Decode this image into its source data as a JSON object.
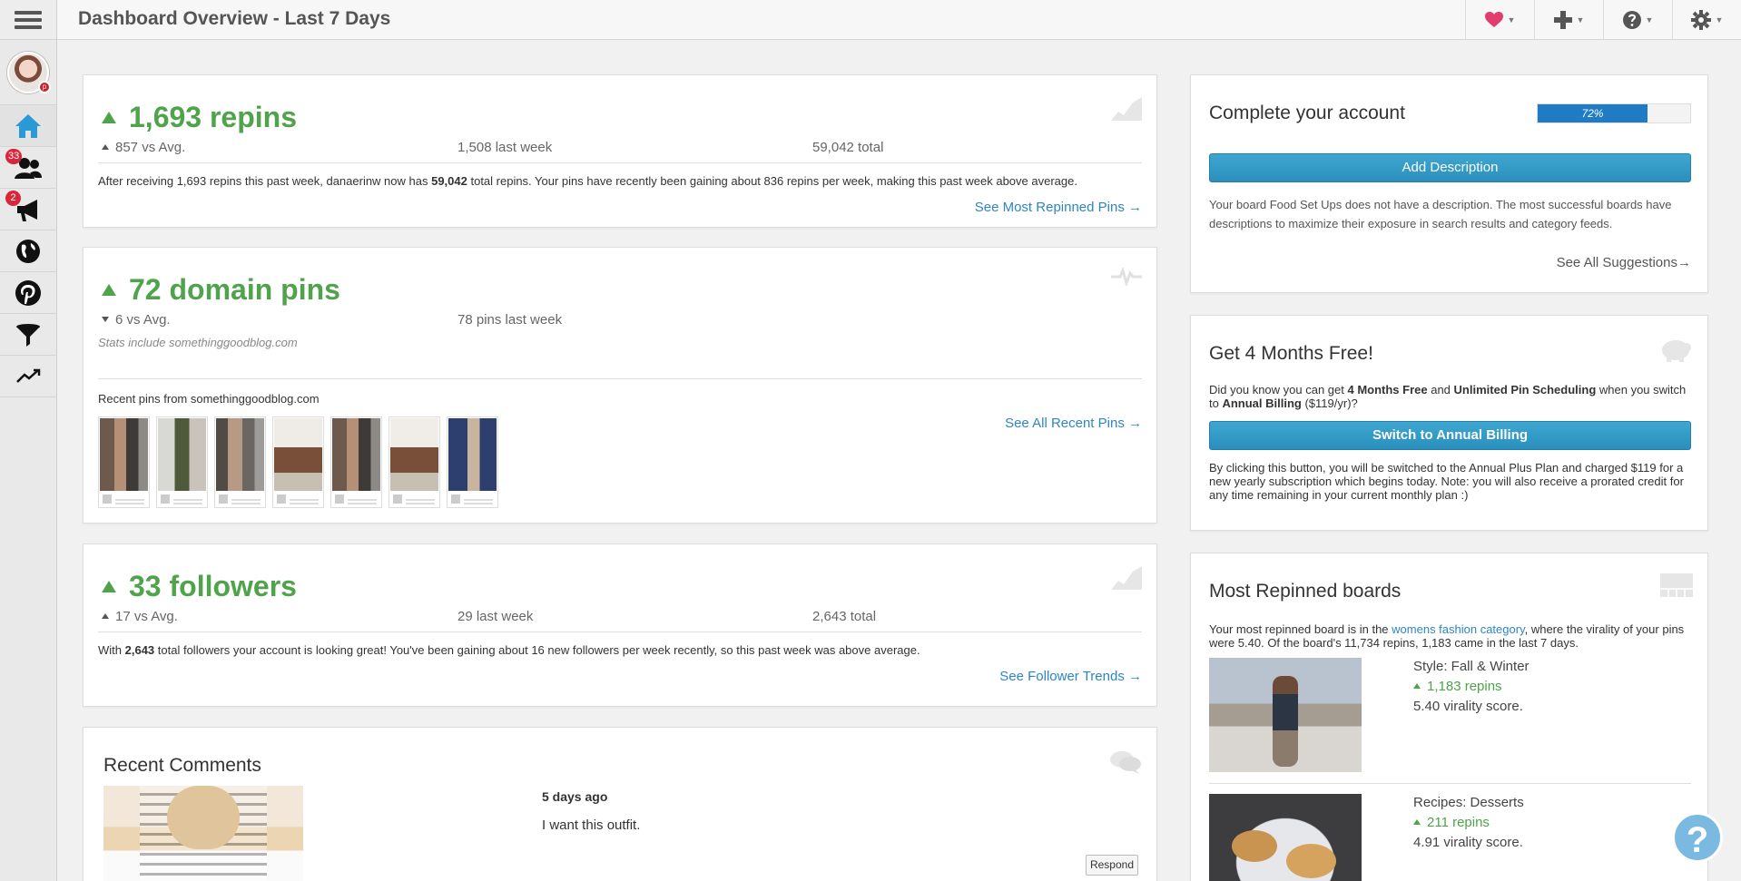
{
  "header": {
    "title": "Dashboard Overview - Last 7 Days"
  },
  "sidebar": {
    "followers_badge": "33",
    "promote_badge": "2"
  },
  "repins_card": {
    "headline": "1,693 repins",
    "vs_avg": "857 vs Avg.",
    "last_week": "1,508 last week",
    "total": "59,042 total",
    "summary_pre": "After receiving 1,693 repins this past week, danaerinw now has ",
    "summary_bold": "59,042",
    "summary_post": " total repins. Your pins have recently been gaining about 836 repins per week, making this past week above average.",
    "link": "See Most Repinned Pins →"
  },
  "domain_card": {
    "headline": "72 domain pins",
    "vs_avg": "6 vs Avg.",
    "last_week": "78 pins last week",
    "stats_note": "Stats include somethinggoodblog.com",
    "recent_label": "Recent pins from somethinggoodblog.com",
    "link": "See All Recent Pins →"
  },
  "followers_card": {
    "headline": "33 followers",
    "vs_avg": "17 vs Avg.",
    "last_week": "29 last week",
    "total": "2,643 total",
    "summary_pre": "With ",
    "summary_bold": "2,643",
    "summary_post": " total followers your account is looking great! You've been gaining about 16 new followers per week recently, so this past week was above average.",
    "link": "See Follower Trends →"
  },
  "comments_card": {
    "title": "Recent Comments",
    "time": "5 days ago",
    "comment": "I want this outfit.",
    "respond": "Respond"
  },
  "account_card": {
    "title": "Complete your account",
    "progress_label": "72%",
    "progress_value": 0.72,
    "button": "Add Description",
    "description": "Your board Food Set Ups does not have a description. The most successful boards have descriptions to maximize their exposure in search results and category feeds.",
    "link": "See All Suggestions→"
  },
  "promo_card": {
    "title": "Get 4 Months Free!",
    "line_a": "Did you know you can get ",
    "line_b": "4 Months Free",
    "line_c": " and ",
    "line_d": "Unlimited Pin Scheduling",
    "line_e": " when you switch to ",
    "line_f": "Annual Billing",
    "line_g": " ($119/yr)?",
    "button": "Switch to Annual Billing",
    "fine_print": "By clicking this button, you will be switched to the Annual Plus Plan and charged $119 for a new yearly subscription which begins today. Note: you will also receive a prorated credit for any time remaining in your current monthly plan :)"
  },
  "boards_card": {
    "title": "Most Repinned boards",
    "intro_pre": "Your most repinned board is in the ",
    "intro_link": "womens fashion category",
    "intro_post": ", where the virality of your pins were 5.40. Of the board's 11,734 repins, 1,183 came in the last 7 days.",
    "boards": [
      {
        "name": "Style: Fall & Winter",
        "repins": "1,183 repins",
        "virality": "5.40 virality score."
      },
      {
        "name": "Recipes: Desserts",
        "repins": "211 repins",
        "virality": "4.91 virality score."
      }
    ]
  },
  "colors": {
    "accent_green": "#4fa34a",
    "link_blue": "#2e86c1",
    "button_blue": "#2a8fbc",
    "badge_red": "#d9263a"
  }
}
